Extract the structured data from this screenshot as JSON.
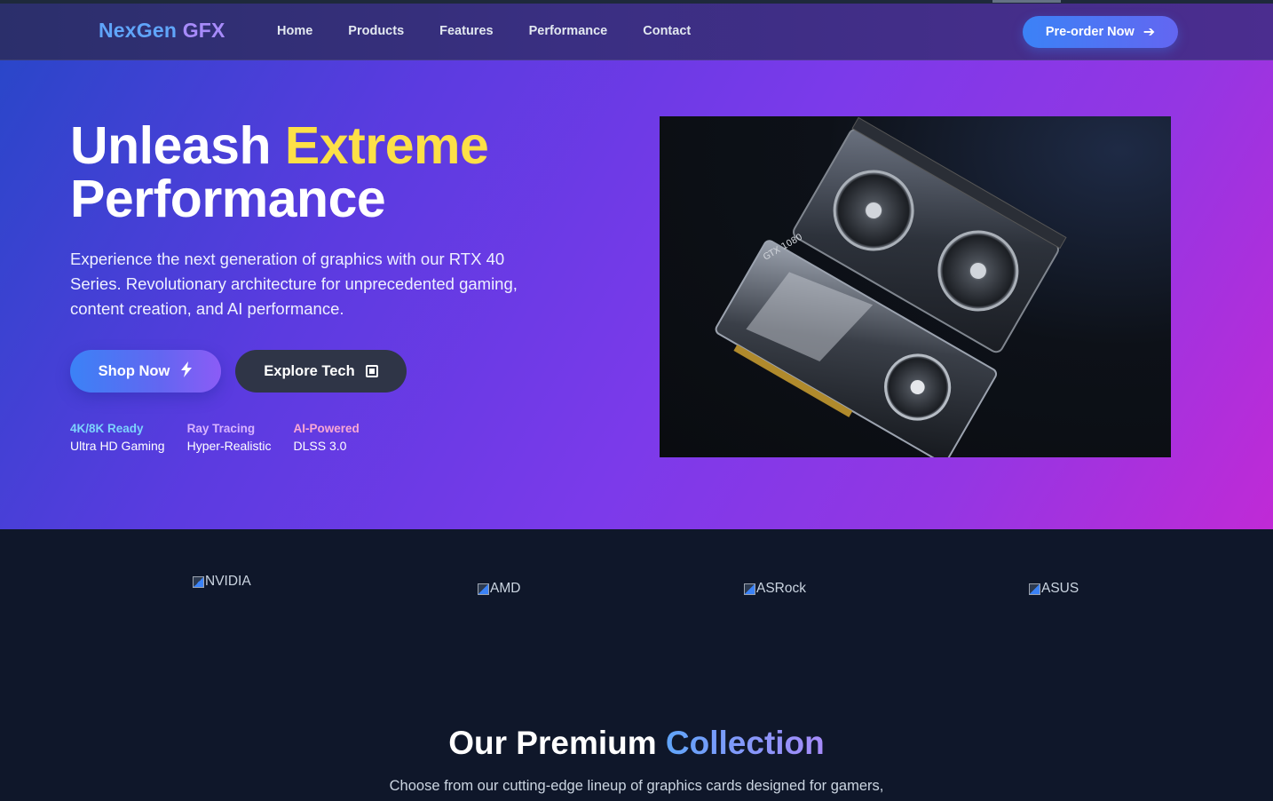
{
  "nav": {
    "logo_part1": "NexGen",
    "logo_part2": "GFX",
    "links": [
      "Home",
      "Products",
      "Features",
      "Performance",
      "Contact"
    ],
    "cta_label": "Pre-order Now",
    "cta_icon": "arrow-right-icon"
  },
  "hero": {
    "title_part1": "Unleash ",
    "title_highlight": "Extreme",
    "title_part2": "Performance",
    "description": "Experience the next generation of graphics with our RTX 40 Series. Revolutionary architecture for unprecedented gaming, content creation, and AI performance.",
    "primary_button": "Shop Now",
    "primary_icon": "lightning-bolt-icon",
    "secondary_button": "Explore Tech",
    "secondary_icon": "microchip-icon",
    "stats": [
      {
        "title": "4K/8K Ready",
        "subtitle": "Ultra HD Gaming",
        "color": "#7dd3fc"
      },
      {
        "title": "Ray Tracing",
        "subtitle": "Hyper-Realistic",
        "color": "#d8b4fe"
      },
      {
        "title": "AI-Powered",
        "subtitle": "DLSS 3.0",
        "color": "#f9a8d4"
      }
    ],
    "image_card_label": "GTX 1080"
  },
  "brands": [
    "NVIDIA",
    "AMD",
    "ASRock",
    "ASUS"
  ],
  "collection": {
    "title_part1": "Our Premium ",
    "title_part2": "Collection",
    "subtitle": "Choose from our cutting-edge lineup of graphics cards designed for gamers,"
  },
  "colors": {
    "accent_blue": "#3b82f6",
    "accent_yellow": "#fde047",
    "dark_bg": "#0f172a"
  }
}
